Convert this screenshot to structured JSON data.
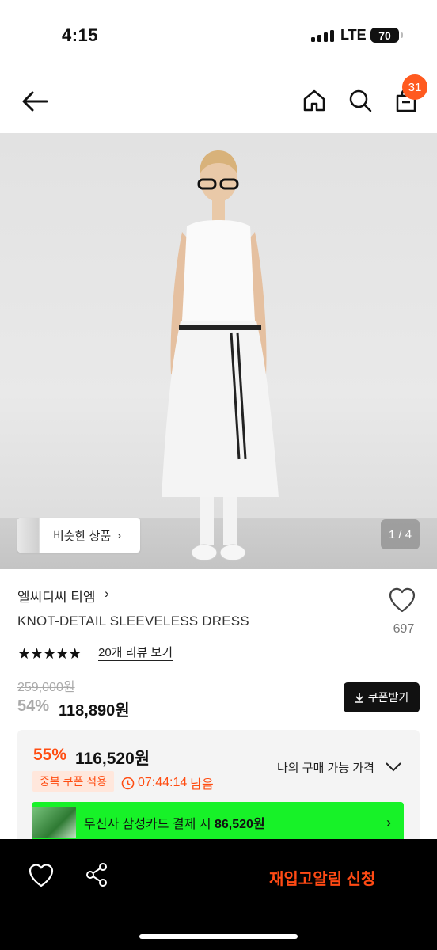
{
  "status_bar": {
    "time": "4:15",
    "network": "LTE",
    "battery": "70"
  },
  "nav": {
    "cart_count": "31"
  },
  "image": {
    "counter": "1 / 4",
    "similar_label": "비슷한 상품"
  },
  "product": {
    "brand": "엘씨디씨 티엠",
    "name": "KNOT-DETAIL SLEEVELESS DRESS",
    "likes": "697",
    "stars": "★★★★★",
    "review_link": "20개 리뷰 보기",
    "original_price": "259,000원",
    "discount": "54%",
    "price": "118,890원",
    "coupon_button": "쿠폰받기"
  },
  "my_price": {
    "discount": "55%",
    "price": "116,520원",
    "label": "나의 구매 가능 가격",
    "badge": "중복 쿠폰 적용",
    "timer": "07:44:14",
    "timer_suffix": "남음",
    "banner_text": "무신사 삼성카드 결제 시",
    "banner_price": "86,520원"
  },
  "bottom_bar": {
    "cta": "재입고알림 신청"
  },
  "colors": {
    "accent": "#ff4d12",
    "banner": "#17f228",
    "bar": "#000000"
  },
  "icons": [
    "back-arrow-icon",
    "home-icon",
    "search-icon",
    "cart-icon",
    "heart-icon",
    "share-icon",
    "download-icon",
    "clock-icon",
    "chevron-right-icon",
    "chevron-down-icon"
  ]
}
